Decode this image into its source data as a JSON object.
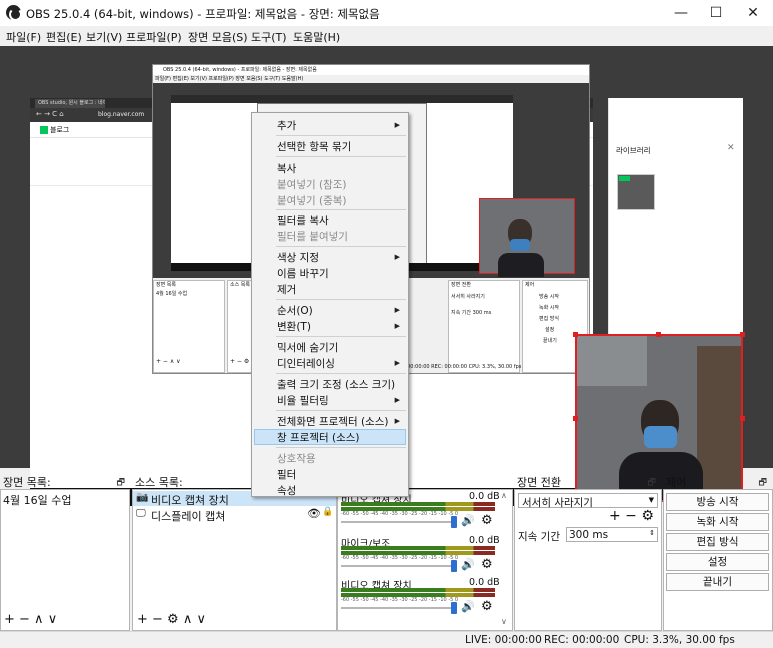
{
  "window": {
    "title": "OBS 25.0.4 (64-bit, windows) - 프로파일: 제목없음 - 장면: 제목없음",
    "minimize_icon": "—",
    "maximize_icon": "☐",
    "close_icon": "✕"
  },
  "menu": [
    "파일(F)",
    "편집(E)",
    "보기(V)",
    "프로파일(P)",
    "장면 모음(S)",
    "도구(T)",
    "도움말(H)"
  ],
  "browser": {
    "tab": "OBS studio, 원시 블로그 : 네이버",
    "url": "blog.naver.com",
    "blog_logo": "블로그",
    "library_label": "라이브러리",
    "inner_title": "OBS 25.0.4 (64-bit, windows) - 프로파일: 제목없음 - 장면: 제목없음",
    "inner_menu": "파일(F) 편집(E) 보기(V) 프로파일(P) 장면 모음(S) 도구(T) 도움말(H)",
    "inner_scene_header": "장면 목록",
    "inner_scene_item": "4월 16일 수업",
    "inner_source_header": "소스 목록",
    "inner_transition_header": "장면 전환",
    "inner_transition_value": "서서히 사라지기",
    "inner_duration": "지속 기간 300 ms",
    "inner_control_header": "제어",
    "inner_controls": [
      "방송 시작",
      "녹화 시작",
      "편집 방식",
      "설정",
      "끝내기"
    ],
    "inner_status": "LIVE: 00:00:00   REC: 00:00:00   CPU: 3.3%, 30.00 fps"
  },
  "context_menu": {
    "items": [
      {
        "label": "추가",
        "submenu": true,
        "disabled": false
      },
      {
        "label": "선택한 항목 묶기",
        "submenu": false,
        "disabled": false
      },
      {
        "label": "복사",
        "submenu": false,
        "disabled": false
      },
      {
        "label": "붙여넣기 (참조)",
        "submenu": false,
        "disabled": true
      },
      {
        "label": "붙여넣기 (중복)",
        "submenu": false,
        "disabled": true
      },
      {
        "label": "필터를 복사",
        "submenu": false,
        "disabled": false
      },
      {
        "label": "필터를 붙여넣기",
        "submenu": false,
        "disabled": true
      },
      {
        "label": "색상 지정",
        "submenu": true,
        "disabled": false
      },
      {
        "label": "이름 바꾸기",
        "submenu": false,
        "disabled": false
      },
      {
        "label": "제거",
        "submenu": false,
        "disabled": false
      },
      {
        "label": "순서(O)",
        "submenu": true,
        "disabled": false
      },
      {
        "label": "변환(T)",
        "submenu": true,
        "disabled": false
      },
      {
        "label": "믹서에 숨기기",
        "submenu": false,
        "disabled": false
      },
      {
        "label": "디인터레이싱",
        "submenu": true,
        "disabled": false
      },
      {
        "label": "출력 크기 조정 (소스 크기)",
        "submenu": false,
        "disabled": false
      },
      {
        "label": "비율 필터링",
        "submenu": true,
        "disabled": false
      },
      {
        "label": "전체화면 프로젝터 (소스)",
        "submenu": true,
        "disabled": false
      },
      {
        "label": "창 프로젝터 (소스)",
        "submenu": false,
        "disabled": false,
        "highlighted": true
      },
      {
        "label": "상호작용",
        "submenu": false,
        "disabled": true
      },
      {
        "label": "필터",
        "submenu": false,
        "disabled": false
      },
      {
        "label": "속성",
        "submenu": false,
        "disabled": false
      }
    ],
    "arrow_icon": "▶"
  },
  "scenes": {
    "header": "장면 목록:",
    "items": [
      "4월 16일 수업"
    ],
    "footer": "+ − ∧ ∨"
  },
  "sources": {
    "header": "소스 목록:",
    "items": [
      {
        "label": "비디오 캡쳐 장치",
        "icon": "camera-icon",
        "selected": true
      },
      {
        "label": "디스플레이 캡쳐",
        "icon": "monitor-icon",
        "selected": false
      }
    ],
    "footer": "+ − ⚙ ∧ ∨"
  },
  "mixer": {
    "channels": [
      {
        "name": "비디오 캡쳐 장치",
        "db": "0.0 dB"
      },
      {
        "name": "마이크/보조",
        "db": "0.0 dB"
      },
      {
        "name": "비디오 캡쳐 장치",
        "db": "0.0 dB"
      }
    ],
    "ticks": "-60 -55 -50 -45 -40 -35 -30 -25 -20 -15 -10 -5 0"
  },
  "transitions": {
    "header": "장면 전환",
    "selected": "서서히 사라지기",
    "duration_label": "지속 기간",
    "duration_value": "300 ms",
    "buttons": "+ − ⚙"
  },
  "controls": {
    "header": "제어",
    "buttons": [
      "방송 시작",
      "녹화 시작",
      "편집 방식",
      "설정",
      "끝내기"
    ]
  },
  "status": {
    "live": "LIVE: 00:00:00",
    "rec": "REC: 00:00:00",
    "cpu": "CPU: 3.3%, 30.00 fps"
  },
  "dock_pin_icon": "🗗",
  "colors": {
    "accent_blue": "#cce4f7",
    "selection_red": "#e02020",
    "naver_green": "#03c75a",
    "preview_bg": "#3c3c3c"
  }
}
